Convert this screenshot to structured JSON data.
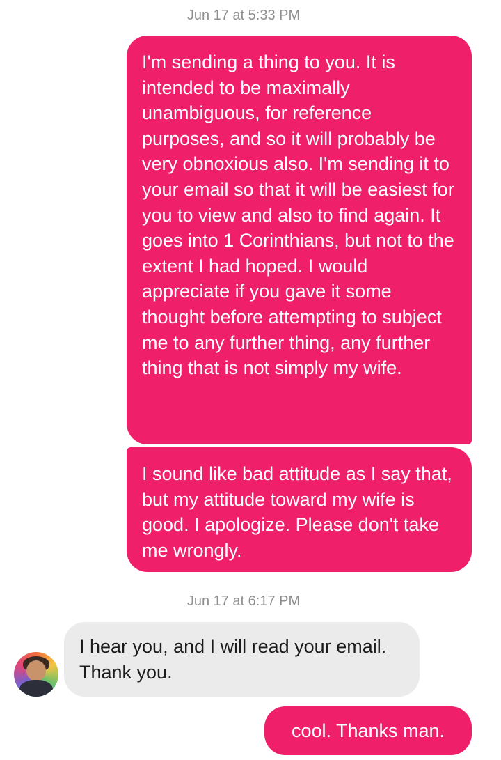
{
  "messages": [
    {
      "type": "timestamp",
      "text": "Jun 17 at 5:33 PM"
    },
    {
      "type": "sent",
      "text": "I'm sending a thing to you. It is intended to be maximally unambiguous, for reference purposes, and so it will probably be very obnoxious also. I'm sending it to your email so that it will be easiest for you to view and also to find again. It goes into 1 Corinthians, but not to the extent I had hoped. I would appreciate if you gave it some thought before attempting to subject me to any further thing, any further thing that is not simply my wife."
    },
    {
      "type": "sent",
      "text": "I sound like bad attitude as I say that, but my attitude toward my wife is good. I apologize. Please don't take me wrongly."
    },
    {
      "type": "timestamp",
      "text": "Jun 17 at 6:17 PM"
    },
    {
      "type": "received",
      "text": "I hear you, and I will read your email. Thank you."
    },
    {
      "type": "sent",
      "text": "cool. Thanks man."
    }
  ],
  "colors": {
    "sent_bubble": "#ef1f6a",
    "received_bubble": "#ebebeb",
    "timestamp_text": "#8e8e8e"
  },
  "icons": {
    "contact_avatar": "avatar-photo"
  }
}
